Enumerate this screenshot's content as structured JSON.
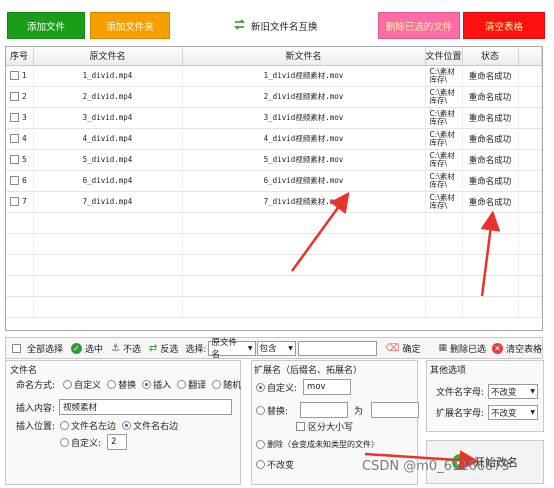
{
  "toolbar": {
    "add_file": "添加文件",
    "add_folder": "添加文件夹",
    "swap": "新旧文件名互换",
    "remove_selected": "删除已选的文件",
    "clear_table": "清空表格"
  },
  "colors": {
    "green": "#1a9e1a",
    "orange": "#f5a000",
    "pink": "#ff6ba6",
    "red": "#ff1010",
    "arrow": "#e8322c"
  },
  "table": {
    "headers": [
      "序号",
      "原文件名",
      "新文件名",
      "文件位置",
      "状态"
    ],
    "rows": [
      {
        "idx": "1",
        "orig": "1_divid.mp4",
        "new": "1_divid视频素材.mov",
        "loc": "C:\\素材库存\\",
        "status": "重命名成功"
      },
      {
        "idx": "2",
        "orig": "2_divid.mp4",
        "new": "2_divid视频素材.mov",
        "loc": "C:\\素材库存\\",
        "status": "重命名成功"
      },
      {
        "idx": "3",
        "orig": "3_divid.mp4",
        "new": "3_divid视频素材.mov",
        "loc": "C:\\素材库存\\",
        "status": "重命名成功"
      },
      {
        "idx": "4",
        "orig": "4_divid.mp4",
        "new": "4_divid视频素材.mov",
        "loc": "C:\\素材库存\\",
        "status": "重命名成功"
      },
      {
        "idx": "5",
        "orig": "5_divid.mp4",
        "new": "5_divid视频素材.mov",
        "loc": "C:\\素材库存\\",
        "status": "重命名成功"
      },
      {
        "idx": "6",
        "orig": "6_divid.mp4",
        "new": "6_divid视频素材.mov",
        "loc": "C:\\素材库存\\",
        "status": "重命名成功"
      },
      {
        "idx": "7",
        "orig": "7_divid.mp4",
        "new": "7_divid视频素材.mov",
        "loc": "C:\\素材库存\\",
        "status": "重命名成功"
      }
    ]
  },
  "selbar": {
    "select_all": "全部选择",
    "select_mid": "选中",
    "deselect": "不选",
    "invert": "反选",
    "choose_label": "选择:",
    "field_select": "原文件名",
    "match_select": "包含",
    "confirm": "确定",
    "remove_selected": "删除已选",
    "clear_table": "清空表格"
  },
  "filename_group": {
    "title": "文件名",
    "mode_label": "命名方式:",
    "mode_options": [
      "自定义",
      "替换",
      "插入",
      "翻译",
      "随机"
    ],
    "insert_content_label": "插入内容:",
    "insert_content_value": "视频素材",
    "insert_pos_label": "插入位置:",
    "pos_left": "文件名左边",
    "pos_right": "文件名右边",
    "custom_label": "自定义:",
    "custom_value": "2"
  },
  "ext_group": {
    "title": "扩展名（后缀名、拓展名）",
    "custom_label": "自定义:",
    "custom_value": "mov",
    "replace_label": "替换:",
    "as_label": "为",
    "case_label": "区分大小写",
    "delete_label": "删除（会变成未知类型的文件）",
    "no_change_label": "不改变"
  },
  "other_group": {
    "title": "其他选项",
    "name_case_label": "文件名字母:",
    "name_case_value": "不改变",
    "ext_case_label": "扩展名字母:",
    "ext_case_value": "不改变"
  },
  "start_button": "开始改名",
  "watermark": "CSDN @m0_61166673"
}
